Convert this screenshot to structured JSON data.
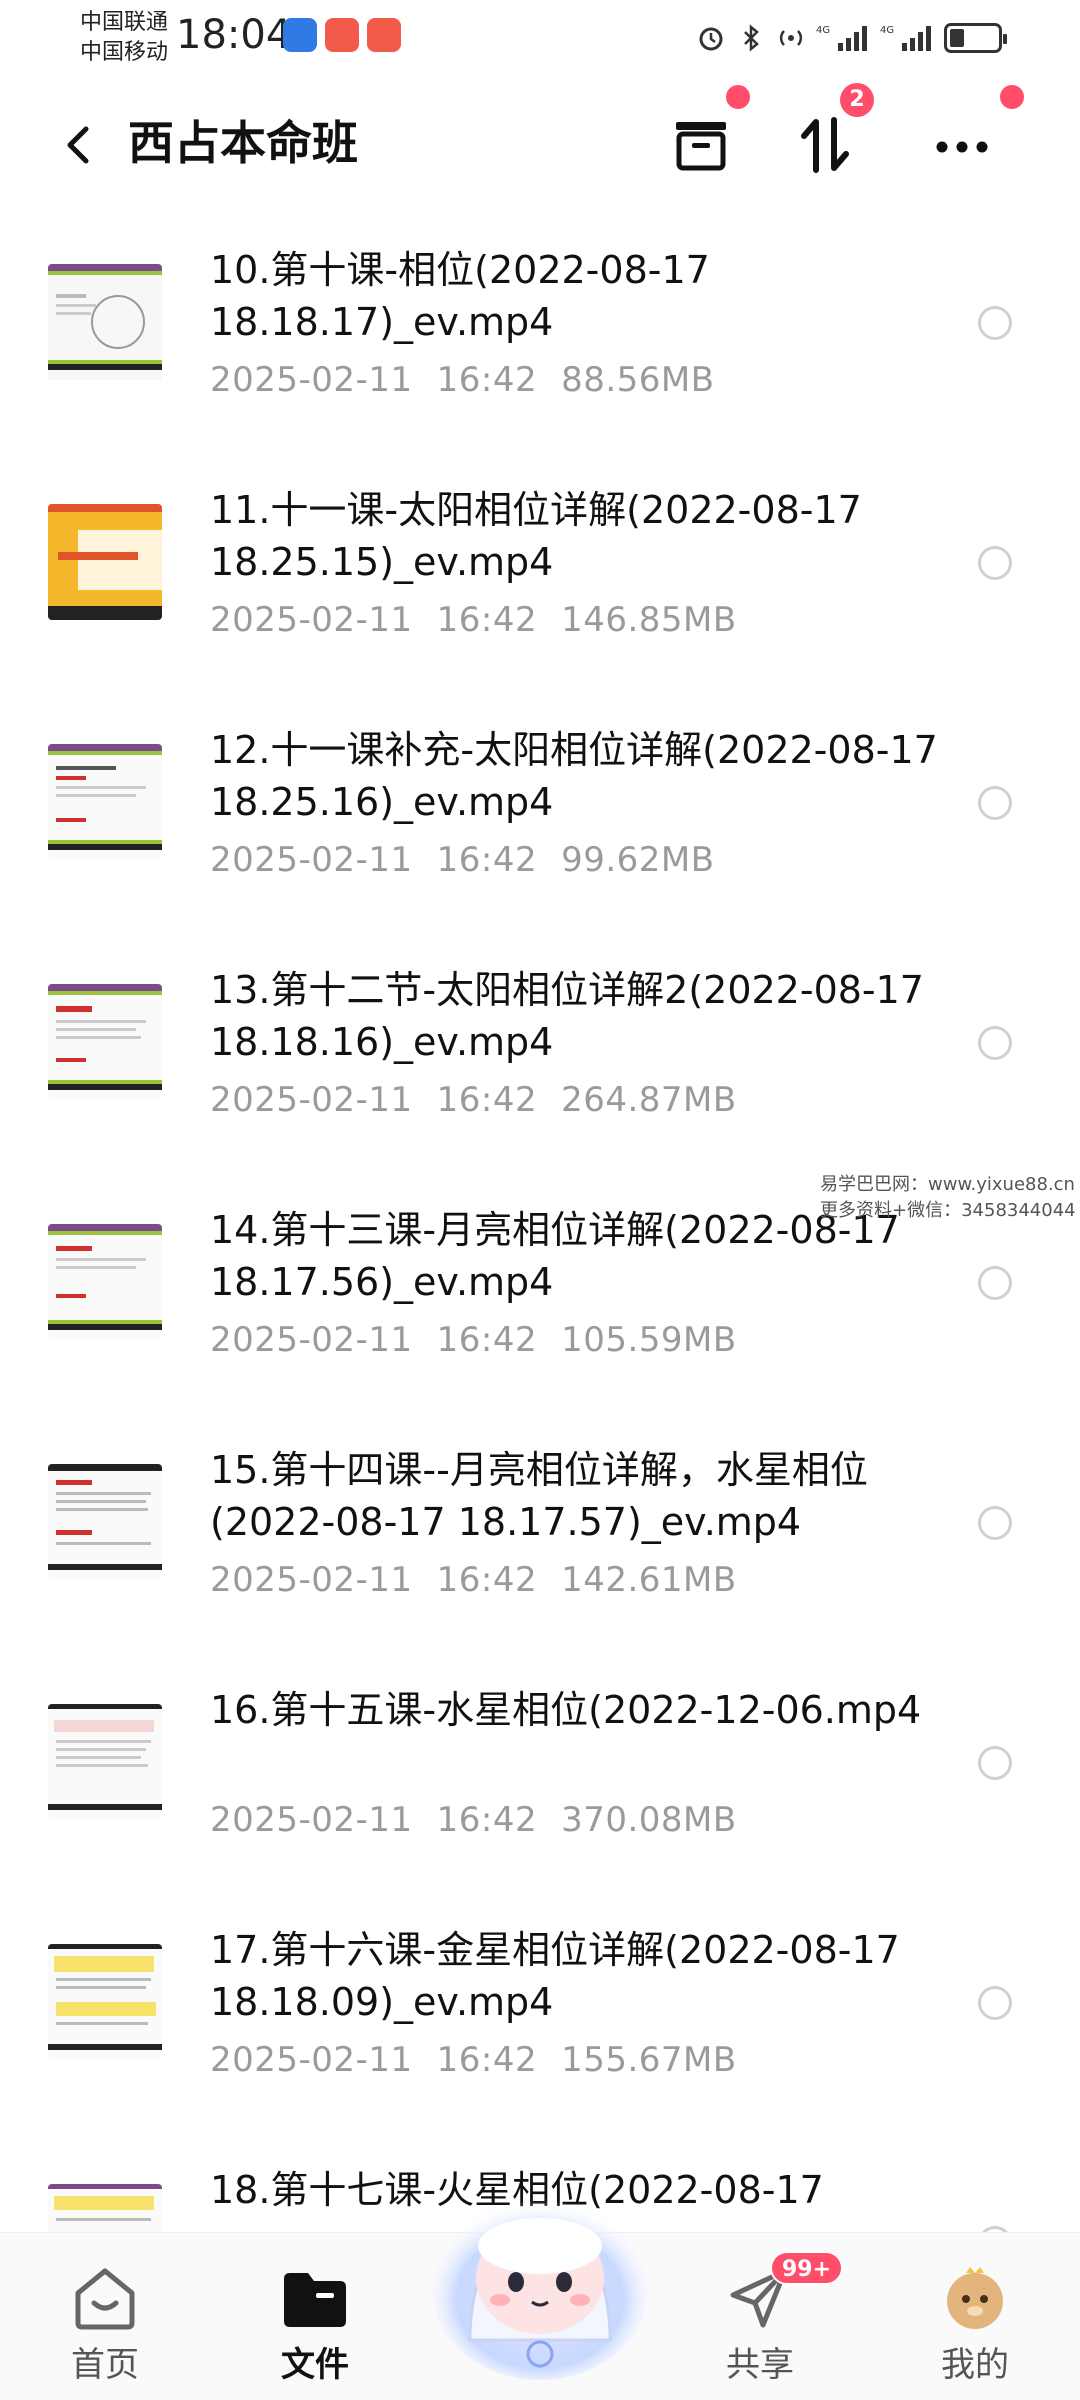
{
  "status_bar": {
    "carrier_1": "中国联通",
    "carrier_2": "中国移动",
    "time": "18:04",
    "network_1": "4G",
    "network_2": "4G"
  },
  "header": {
    "title": "西占本命班",
    "transfer_badge": "2"
  },
  "files": [
    {
      "name": "10.第十课-相位(2022-08-17 18.18.17)_ev.mp4",
      "date": "2025-02-11",
      "time": "16:42",
      "size": "88.56MB"
    },
    {
      "name": "11.十一课-太阳相位详解(2022-08-17 18.25.15)_ev.mp4",
      "date": "2025-02-11",
      "time": "16:42",
      "size": "146.85MB"
    },
    {
      "name": "12.十一课补充-太阳相位详解(2022-08-17 18.25.16)_ev.mp4",
      "date": "2025-02-11",
      "time": "16:42",
      "size": "99.62MB"
    },
    {
      "name": "13.第十二节-太阳相位详解2(2022-08-17 18.18.16)_ev.mp4",
      "date": "2025-02-11",
      "time": "16:42",
      "size": "264.87MB"
    },
    {
      "name": "14.第十三课-月亮相位详解(2022-08-17 18.17.56)_ev.mp4",
      "date": "2025-02-11",
      "time": "16:42",
      "size": "105.59MB"
    },
    {
      "name": "15.第十四课--月亮相位详解，水星相位(2022-08-17 18.17.57)_ev.mp4",
      "date": "2025-02-11",
      "time": "16:42",
      "size": "142.61MB"
    },
    {
      "name": "16.第十五课-水星相位(2022-12-06.mp4",
      "date": "2025-02-11",
      "time": "16:42",
      "size": "370.08MB"
    },
    {
      "name": "17.第十六课-金星相位详解(2022-08-17 18.18.09)_ev.mp4",
      "date": "2025-02-11",
      "time": "16:42",
      "size": "155.67MB"
    },
    {
      "name": "18.第十七课-火星相位(2022-08-17",
      "date": "",
      "time": "",
      "size": ""
    }
  ],
  "watermark": {
    "line1": "易学巴巴网：www.yixue88.cn",
    "line2": "更多资料+微信：3458344044"
  },
  "nav": {
    "home": "首页",
    "files": "文件",
    "share": "共享",
    "share_badge": "99+",
    "mine": "我的"
  },
  "colors": {
    "accent": "#ff4d6a",
    "meta_text": "#9a9a9a",
    "title_text": "#111111"
  }
}
